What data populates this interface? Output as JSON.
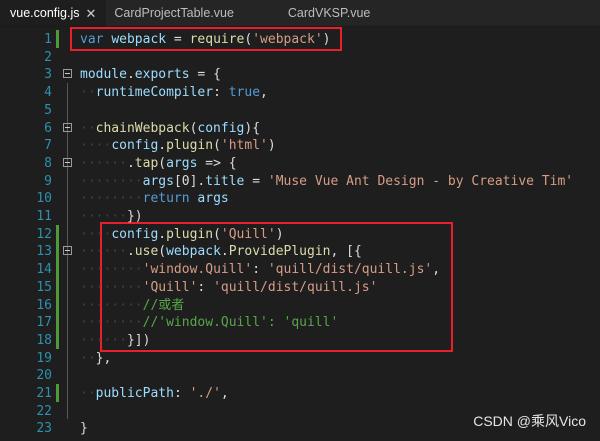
{
  "tabs": [
    {
      "label": "vue.config.js",
      "active": true,
      "close": "✕"
    },
    {
      "label": "CardProjectTable.vue",
      "active": false
    },
    {
      "label": "CardVKSP.vue",
      "active": false
    }
  ],
  "lines": [
    {
      "n": "1",
      "indent": "",
      "tokens": [
        [
          "kw",
          "var"
        ],
        [
          "pl",
          " "
        ],
        [
          "id",
          "webpack"
        ],
        [
          "pl",
          " = "
        ],
        [
          "fn",
          "require"
        ],
        [
          "pl",
          "("
        ],
        [
          "str",
          "'webpack'"
        ],
        [
          "pl",
          ")"
        ]
      ]
    },
    {
      "n": "2",
      "indent": "",
      "tokens": []
    },
    {
      "n": "3",
      "indent": "",
      "tokens": [
        [
          "id",
          "module"
        ],
        [
          "pl",
          "."
        ],
        [
          "id",
          "exports"
        ],
        [
          "pl",
          " = {"
        ]
      ]
    },
    {
      "n": "4",
      "indent": "  ",
      "tokens": [
        [
          "id",
          "runtimeCompiler"
        ],
        [
          "pl",
          ": "
        ],
        [
          "kw",
          "true"
        ],
        [
          "pl",
          ","
        ]
      ]
    },
    {
      "n": "5",
      "indent": "",
      "tokens": []
    },
    {
      "n": "6",
      "indent": "  ",
      "tokens": [
        [
          "fn",
          "chainWebpack"
        ],
        [
          "pl",
          "("
        ],
        [
          "id",
          "config"
        ],
        [
          "pl",
          "){"
        ]
      ]
    },
    {
      "n": "7",
      "indent": "    ",
      "tokens": [
        [
          "id",
          "config"
        ],
        [
          "pl",
          "."
        ],
        [
          "fn",
          "plugin"
        ],
        [
          "pl",
          "("
        ],
        [
          "str",
          "'html'"
        ],
        [
          "pl",
          ")"
        ]
      ]
    },
    {
      "n": "8",
      "indent": "      ",
      "tokens": [
        [
          "pl",
          "."
        ],
        [
          "fn",
          "tap"
        ],
        [
          "pl",
          "("
        ],
        [
          "id",
          "args"
        ],
        [
          "pl",
          " => {"
        ]
      ]
    },
    {
      "n": "9",
      "indent": "        ",
      "tokens": [
        [
          "id",
          "args"
        ],
        [
          "pl",
          "["
        ],
        [
          "pl",
          "0"
        ],
        [
          "pl",
          "]."
        ],
        [
          "id",
          "title"
        ],
        [
          "pl",
          " = "
        ],
        [
          "str",
          "'Muse Vue Ant Design - by Creative Tim'"
        ]
      ]
    },
    {
      "n": "10",
      "indent": "        ",
      "tokens": [
        [
          "kw",
          "return"
        ],
        [
          "pl",
          " "
        ],
        [
          "id",
          "args"
        ]
      ]
    },
    {
      "n": "11",
      "indent": "      ",
      "tokens": [
        [
          "pl",
          "})"
        ]
      ]
    },
    {
      "n": "12",
      "indent": "    ",
      "tokens": [
        [
          "id",
          "config"
        ],
        [
          "pl",
          "."
        ],
        [
          "fn",
          "plugin"
        ],
        [
          "pl",
          "("
        ],
        [
          "str",
          "'Quill'"
        ],
        [
          "pl",
          ")"
        ]
      ]
    },
    {
      "n": "13",
      "indent": "      ",
      "tokens": [
        [
          "pl",
          "."
        ],
        [
          "fn",
          "use"
        ],
        [
          "pl",
          "("
        ],
        [
          "id",
          "webpack"
        ],
        [
          "pl",
          "."
        ],
        [
          "fn",
          "ProvidePlugin"
        ],
        [
          "pl",
          ", [{"
        ]
      ]
    },
    {
      "n": "14",
      "indent": "        ",
      "tokens": [
        [
          "str",
          "'window.Quill'"
        ],
        [
          "pl",
          ": "
        ],
        [
          "str",
          "'quill/dist/quill.js'"
        ],
        [
          "pl",
          ","
        ]
      ]
    },
    {
      "n": "15",
      "indent": "        ",
      "tokens": [
        [
          "str",
          "'Quill'"
        ],
        [
          "pl",
          ": "
        ],
        [
          "str",
          "'quill/dist/quill.js'"
        ]
      ]
    },
    {
      "n": "16",
      "indent": "        ",
      "tokens": [
        [
          "cm",
          "//或者"
        ]
      ]
    },
    {
      "n": "17",
      "indent": "        ",
      "tokens": [
        [
          "cm",
          "//'window.Quill': 'quill'"
        ]
      ]
    },
    {
      "n": "18",
      "indent": "      ",
      "tokens": [
        [
          "pl",
          "}])"
        ]
      ]
    },
    {
      "n": "19",
      "indent": "  ",
      "tokens": [
        [
          "pl",
          "},"
        ]
      ]
    },
    {
      "n": "20",
      "indent": "",
      "tokens": []
    },
    {
      "n": "21",
      "indent": "  ",
      "tokens": [
        [
          "id",
          "publicPath"
        ],
        [
          "pl",
          ": "
        ],
        [
          "str",
          "'./'"
        ],
        [
          "pl",
          ","
        ]
      ]
    },
    {
      "n": "22",
      "indent": "",
      "tokens": []
    },
    {
      "n": "23",
      "indent": "",
      "tokens": [
        [
          "pl",
          "}"
        ]
      ]
    }
  ],
  "watermark": "CSDN @乘风Vico",
  "colors": {
    "background": "#1e1e1e",
    "line_number": "#2b91af",
    "keyword": "#569cd6",
    "identifier": "#9cdcfe",
    "function": "#dcdcaa",
    "string": "#d69d85",
    "comment": "#57a64a",
    "highlight_box": "#e8202a",
    "change_bar": "#4e9a3a"
  }
}
